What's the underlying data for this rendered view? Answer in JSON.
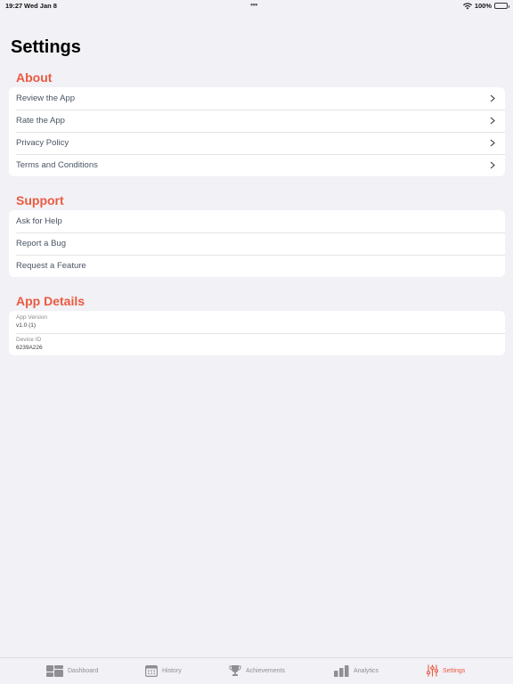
{
  "status": {
    "time": "19:27",
    "date": "Wed Jan 8",
    "battery": "100%"
  },
  "page": {
    "title": "Settings"
  },
  "sections": {
    "about": {
      "header": "About",
      "items": [
        {
          "label": "Review the App"
        },
        {
          "label": "Rate the App"
        },
        {
          "label": "Privacy Policy"
        },
        {
          "label": "Terms and Conditions"
        }
      ]
    },
    "support": {
      "header": "Support",
      "items": [
        {
          "label": "Ask for Help"
        },
        {
          "label": "Report a Bug"
        },
        {
          "label": "Request a Feature"
        }
      ]
    },
    "app_details": {
      "header": "App Details",
      "items": [
        {
          "label": "App Version",
          "value": "v1.0 (1)"
        },
        {
          "label": "Device ID",
          "value": "6239A226"
        }
      ]
    }
  },
  "tabs": [
    {
      "label": "Dashboard",
      "icon": "dashboard-icon"
    },
    {
      "label": "History",
      "icon": "calendar-icon"
    },
    {
      "label": "Achievements",
      "icon": "trophy-icon"
    },
    {
      "label": "Analytics",
      "icon": "bar-chart-icon"
    },
    {
      "label": "Settings",
      "icon": "sliders-icon",
      "active": true
    }
  ],
  "colors": {
    "accent": "#ea5a3f",
    "background": "#f1f1f6",
    "card": "#ffffff",
    "row_text": "#4a5563",
    "inactive_tab": "#8e8e93"
  }
}
